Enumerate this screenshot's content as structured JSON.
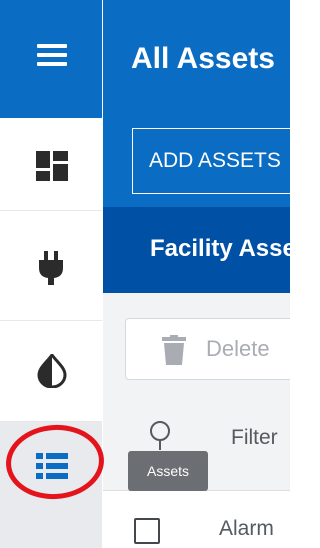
{
  "sidebar": {
    "items": [
      {
        "name": "dashboard",
        "icon": "dashboard-icon",
        "selected": false
      },
      {
        "name": "plug",
        "icon": "plug-icon",
        "selected": false
      },
      {
        "name": "contrast",
        "icon": "contrast-icon",
        "selected": false
      },
      {
        "name": "assets",
        "icon": "list-icon",
        "selected": true
      }
    ],
    "tooltip": "Assets"
  },
  "header": {
    "title": "All Assets",
    "add_button_label": "ADD ASSETS"
  },
  "subheader": {
    "title": "Facility Assets"
  },
  "toolbar": {
    "delete_label": "Delete"
  },
  "table": {
    "filter_placeholder": "Filter",
    "rows": [
      {
        "name": "Alarm"
      }
    ]
  },
  "colors": {
    "primary": "#0a6cc2",
    "primary_dark": "#0050a6",
    "highlight": "#e3141b",
    "tooltip": "#6b6e72"
  }
}
